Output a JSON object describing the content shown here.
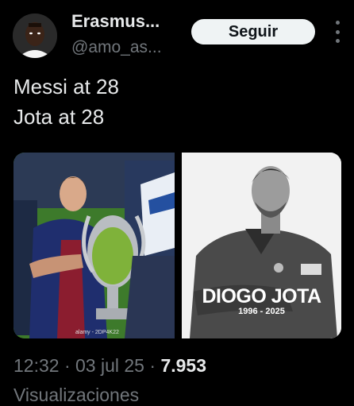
{
  "header": {
    "display_name": "Erasmus...",
    "handle": "@amo_as...",
    "follow_label": "Seguir"
  },
  "tweet": {
    "lines": [
      "Messi at 28",
      "Jota at 28"
    ]
  },
  "media": {
    "left_watermark": "alamy - 2DP4K22",
    "right_name": "DIOGO JOTA",
    "right_years": "1996 - 2025"
  },
  "meta": {
    "time": "12:32",
    "separator": "·",
    "date": "03 jul 25",
    "views_count": "7.953",
    "views_label": "Visualizaciones"
  },
  "colors": {
    "background": "#000000",
    "text": "#e7e9ea",
    "muted": "#71767b",
    "button_bg": "#eff3f4"
  }
}
